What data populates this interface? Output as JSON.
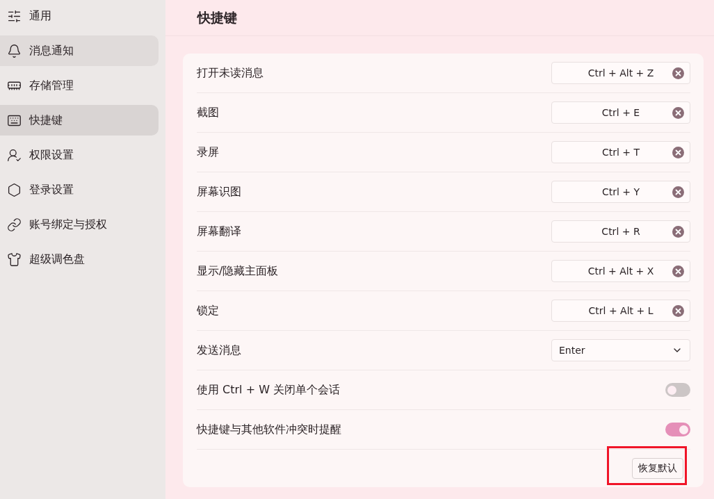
{
  "sidebar": {
    "items": [
      {
        "label": "通用",
        "selected": false,
        "hovered": false
      },
      {
        "label": "消息通知",
        "selected": false,
        "hovered": true
      },
      {
        "label": "存储管理",
        "selected": false,
        "hovered": false
      },
      {
        "label": "快捷键",
        "selected": true,
        "hovered": false
      },
      {
        "label": "权限设置",
        "selected": false,
        "hovered": false
      },
      {
        "label": "登录设置",
        "selected": false,
        "hovered": false
      },
      {
        "label": "账号绑定与授权",
        "selected": false,
        "hovered": false
      },
      {
        "label": "超级调色盘",
        "selected": false,
        "hovered": false
      }
    ]
  },
  "page": {
    "title": "快捷键"
  },
  "settings": [
    {
      "kind": "shortcut",
      "label": "打开未读消息",
      "value": "Ctrl + Alt + Z"
    },
    {
      "kind": "shortcut",
      "label": "截图",
      "value": "Ctrl + E"
    },
    {
      "kind": "shortcut",
      "label": "录屏",
      "value": "Ctrl + T"
    },
    {
      "kind": "shortcut",
      "label": "屏幕识图",
      "value": "Ctrl + Y"
    },
    {
      "kind": "shortcut",
      "label": "屏幕翻译",
      "value": "Ctrl + R"
    },
    {
      "kind": "shortcut",
      "label": "显示/隐藏主面板",
      "value": "Ctrl + Alt + X"
    },
    {
      "kind": "shortcut",
      "label": "锁定",
      "value": "Ctrl + Alt + L"
    },
    {
      "kind": "select",
      "label": "发送消息",
      "value": "Enter"
    },
    {
      "kind": "toggle",
      "label": "使用 Ctrl + W 关闭单个会话",
      "on": false
    },
    {
      "kind": "toggle",
      "label": "快捷键与其他软件冲突时提醒",
      "on": true
    }
  ],
  "restore_button": {
    "label": "恢复默认",
    "highlighted": true
  }
}
